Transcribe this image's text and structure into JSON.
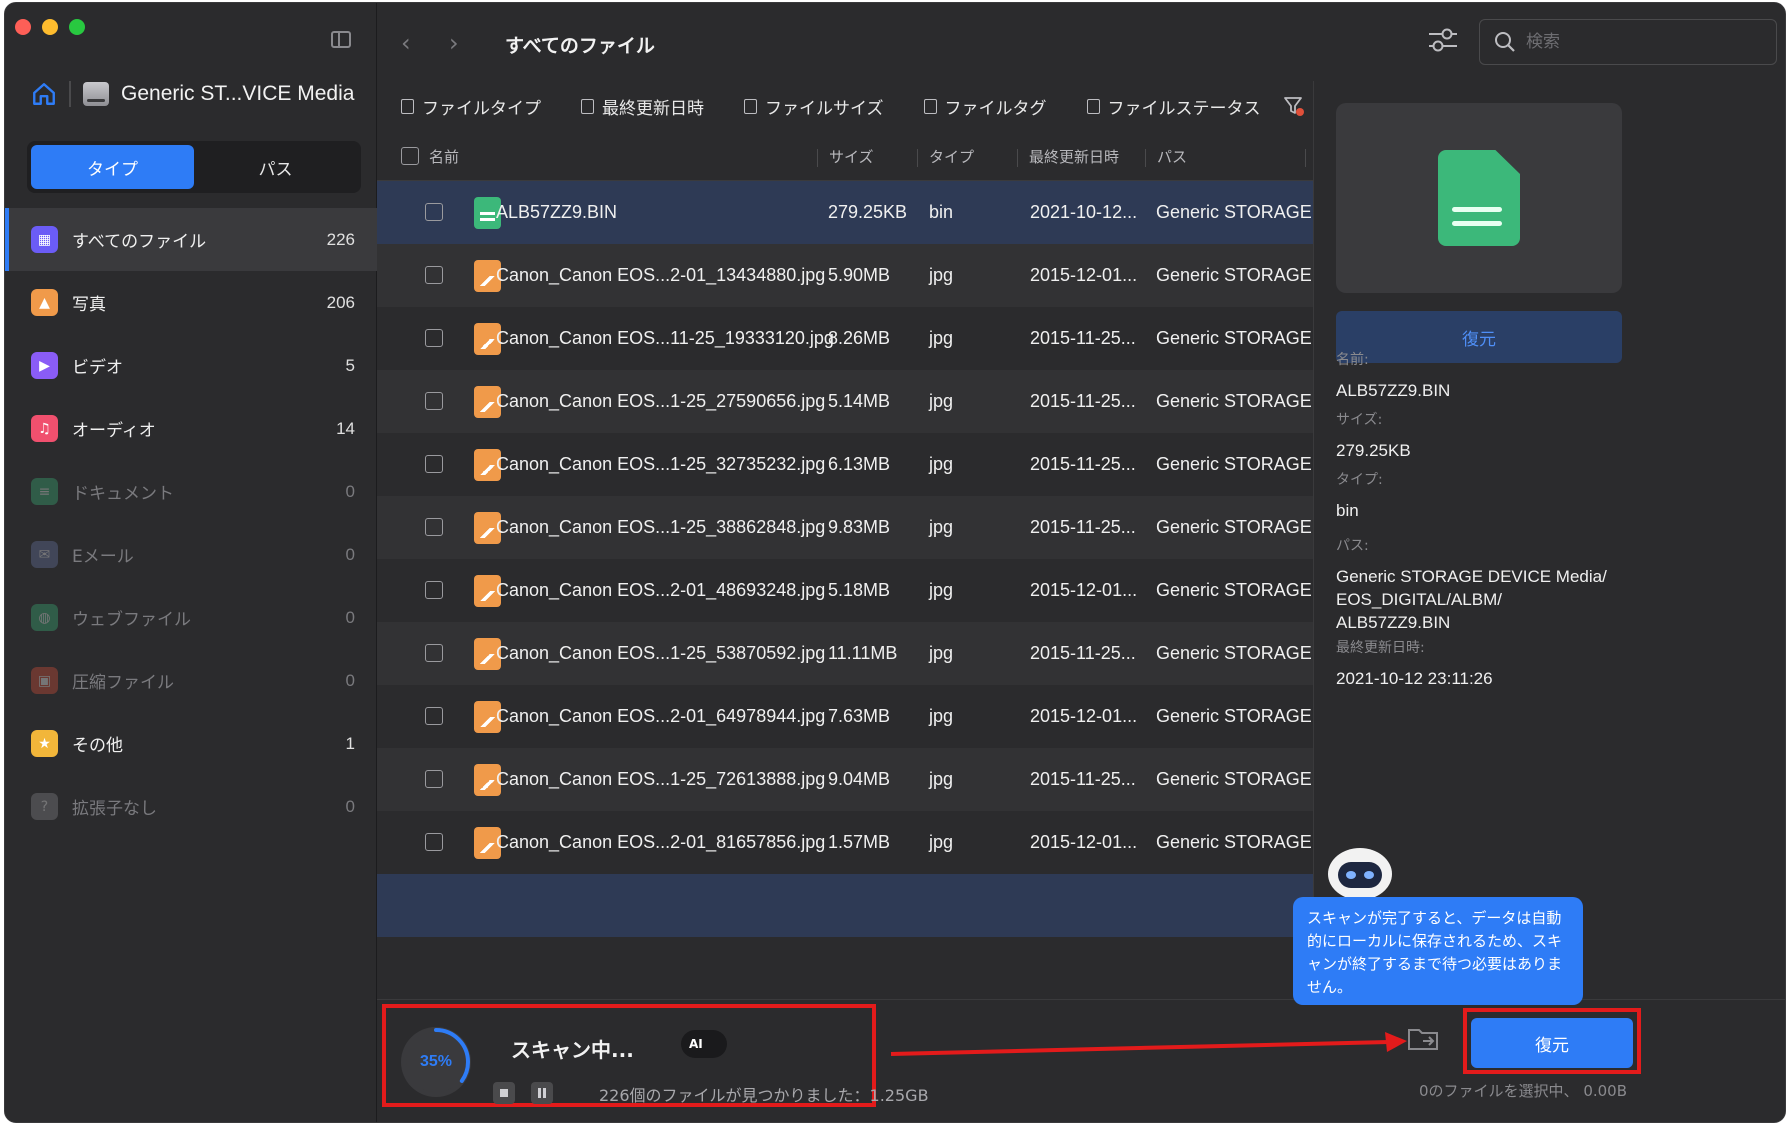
{
  "sidebar": {
    "device_name": "Generic ST...VICE Media",
    "tabs": [
      "タイプ",
      "パス"
    ],
    "categories": [
      {
        "label": "すべてのファイル",
        "count": "226",
        "color": "#6b5cf6",
        "glyph": "▦"
      },
      {
        "label": "写真",
        "count": "206",
        "color": "#f09a4a",
        "glyph": "▲"
      },
      {
        "label": "ビデオ",
        "count": "5",
        "color": "#8a5cf6",
        "glyph": "▶"
      },
      {
        "label": "オーディオ",
        "count": "14",
        "color": "#f0506e",
        "glyph": "♫"
      },
      {
        "label": "ドキュメント",
        "count": "0",
        "color": "#3cb87a",
        "glyph": "≡"
      },
      {
        "label": "Eメール",
        "count": "0",
        "color": "#6a7aa8",
        "glyph": "✉"
      },
      {
        "label": "ウェブファイル",
        "count": "0",
        "color": "#3cb87a",
        "glyph": "◍"
      },
      {
        "label": "圧縮ファイル",
        "count": "0",
        "color": "#e0503a",
        "glyph": "▣"
      },
      {
        "label": "その他",
        "count": "1",
        "color": "#f2b63a",
        "glyph": "★"
      },
      {
        "label": "拡張子なし",
        "count": "0",
        "color": "#8a8a8e",
        "glyph": "?"
      }
    ]
  },
  "header": {
    "title": "すべてのファイル",
    "search_placeholder": "検索"
  },
  "filters": [
    "ファイルタイプ",
    "最終更新日時",
    "ファイルサイズ",
    "ファイルタグ",
    "ファイルステータス"
  ],
  "table": {
    "columns": [
      "名前",
      "サイズ",
      "タイプ",
      "最終更新日時",
      "パス"
    ],
    "rows": [
      {
        "name": "ALB57ZZ9.BIN",
        "size": "279.25KB",
        "type": "bin",
        "date": "2021-10-12...",
        "path": "Generic STORAGE...",
        "kind": "bin"
      },
      {
        "name": "Canon_Canon EOS...2-01_13434880.jpg",
        "size": "5.90MB",
        "type": "jpg",
        "date": "2015-12-01...",
        "path": "Generic STORAGE...",
        "kind": "jpg"
      },
      {
        "name": "Canon_Canon EOS...11-25_19333120.jpg",
        "size": "8.26MB",
        "type": "jpg",
        "date": "2015-11-25...",
        "path": "Generic STORAGE...",
        "kind": "jpg"
      },
      {
        "name": "Canon_Canon EOS...1-25_27590656.jpg",
        "size": "5.14MB",
        "type": "jpg",
        "date": "2015-11-25...",
        "path": "Generic STORAGE...",
        "kind": "jpg"
      },
      {
        "name": "Canon_Canon EOS...1-25_32735232.jpg",
        "size": "6.13MB",
        "type": "jpg",
        "date": "2015-11-25...",
        "path": "Generic STORAGE...",
        "kind": "jpg"
      },
      {
        "name": "Canon_Canon EOS...1-25_38862848.jpg",
        "size": "9.83MB",
        "type": "jpg",
        "date": "2015-11-25...",
        "path": "Generic STORAGE...",
        "kind": "jpg"
      },
      {
        "name": "Canon_Canon EOS...2-01_48693248.jpg",
        "size": "5.18MB",
        "type": "jpg",
        "date": "2015-12-01...",
        "path": "Generic STORAGE...",
        "kind": "jpg"
      },
      {
        "name": "Canon_Canon EOS...1-25_53870592.jpg",
        "size": "11.11MB",
        "type": "jpg",
        "date": "2015-11-25...",
        "path": "Generic STORAGE...",
        "kind": "jpg"
      },
      {
        "name": "Canon_Canon EOS...2-01_64978944.jpg",
        "size": "7.63MB",
        "type": "jpg",
        "date": "2015-12-01...",
        "path": "Generic STORAGE...",
        "kind": "jpg"
      },
      {
        "name": "Canon_Canon EOS...1-25_72613888.jpg",
        "size": "9.04MB",
        "type": "jpg",
        "date": "2015-11-25...",
        "path": "Generic STORAGE...",
        "kind": "jpg"
      },
      {
        "name": "Canon_Canon EOS...2-01_81657856.jpg",
        "size": "1.57MB",
        "type": "jpg",
        "date": "2015-12-01...",
        "path": "Generic STORAGE...",
        "kind": "jpg"
      }
    ]
  },
  "preview": {
    "restore_label": "復元",
    "fields": [
      {
        "key": "名前:",
        "value": "ALB57ZZ9.BIN"
      },
      {
        "key": "サイズ:",
        "value": "279.25KB"
      },
      {
        "key": "タイプ:",
        "value": "bin"
      },
      {
        "key": "パス:",
        "value": "Generic STORAGE DEVICE Media/\nEOS_DIGITAL/ALBM/\nALB57ZZ9.BIN"
      },
      {
        "key": "最終更新日時:",
        "value": "2021-10-12 23:11:26"
      }
    ]
  },
  "scan": {
    "progress_label": "35%",
    "progress_fraction": 0.35,
    "title": "スキャン中...",
    "ai_badge": "AI",
    "found_text": "226個のファイルが見つかりました：1.25GB",
    "tooltip_text": "スキャンが完了すると、データは自動的にローカルに保存されるため、スキャンが終了するまで待つ必要はありません。"
  },
  "footer": {
    "restore_label": "復元",
    "selected_info": "0のファイルを選択中、 0.00B"
  },
  "colors": {
    "accent": "#2e7cf6",
    "highlight_box": "#e31b1b",
    "selected_row": "#2e3a55"
  }
}
